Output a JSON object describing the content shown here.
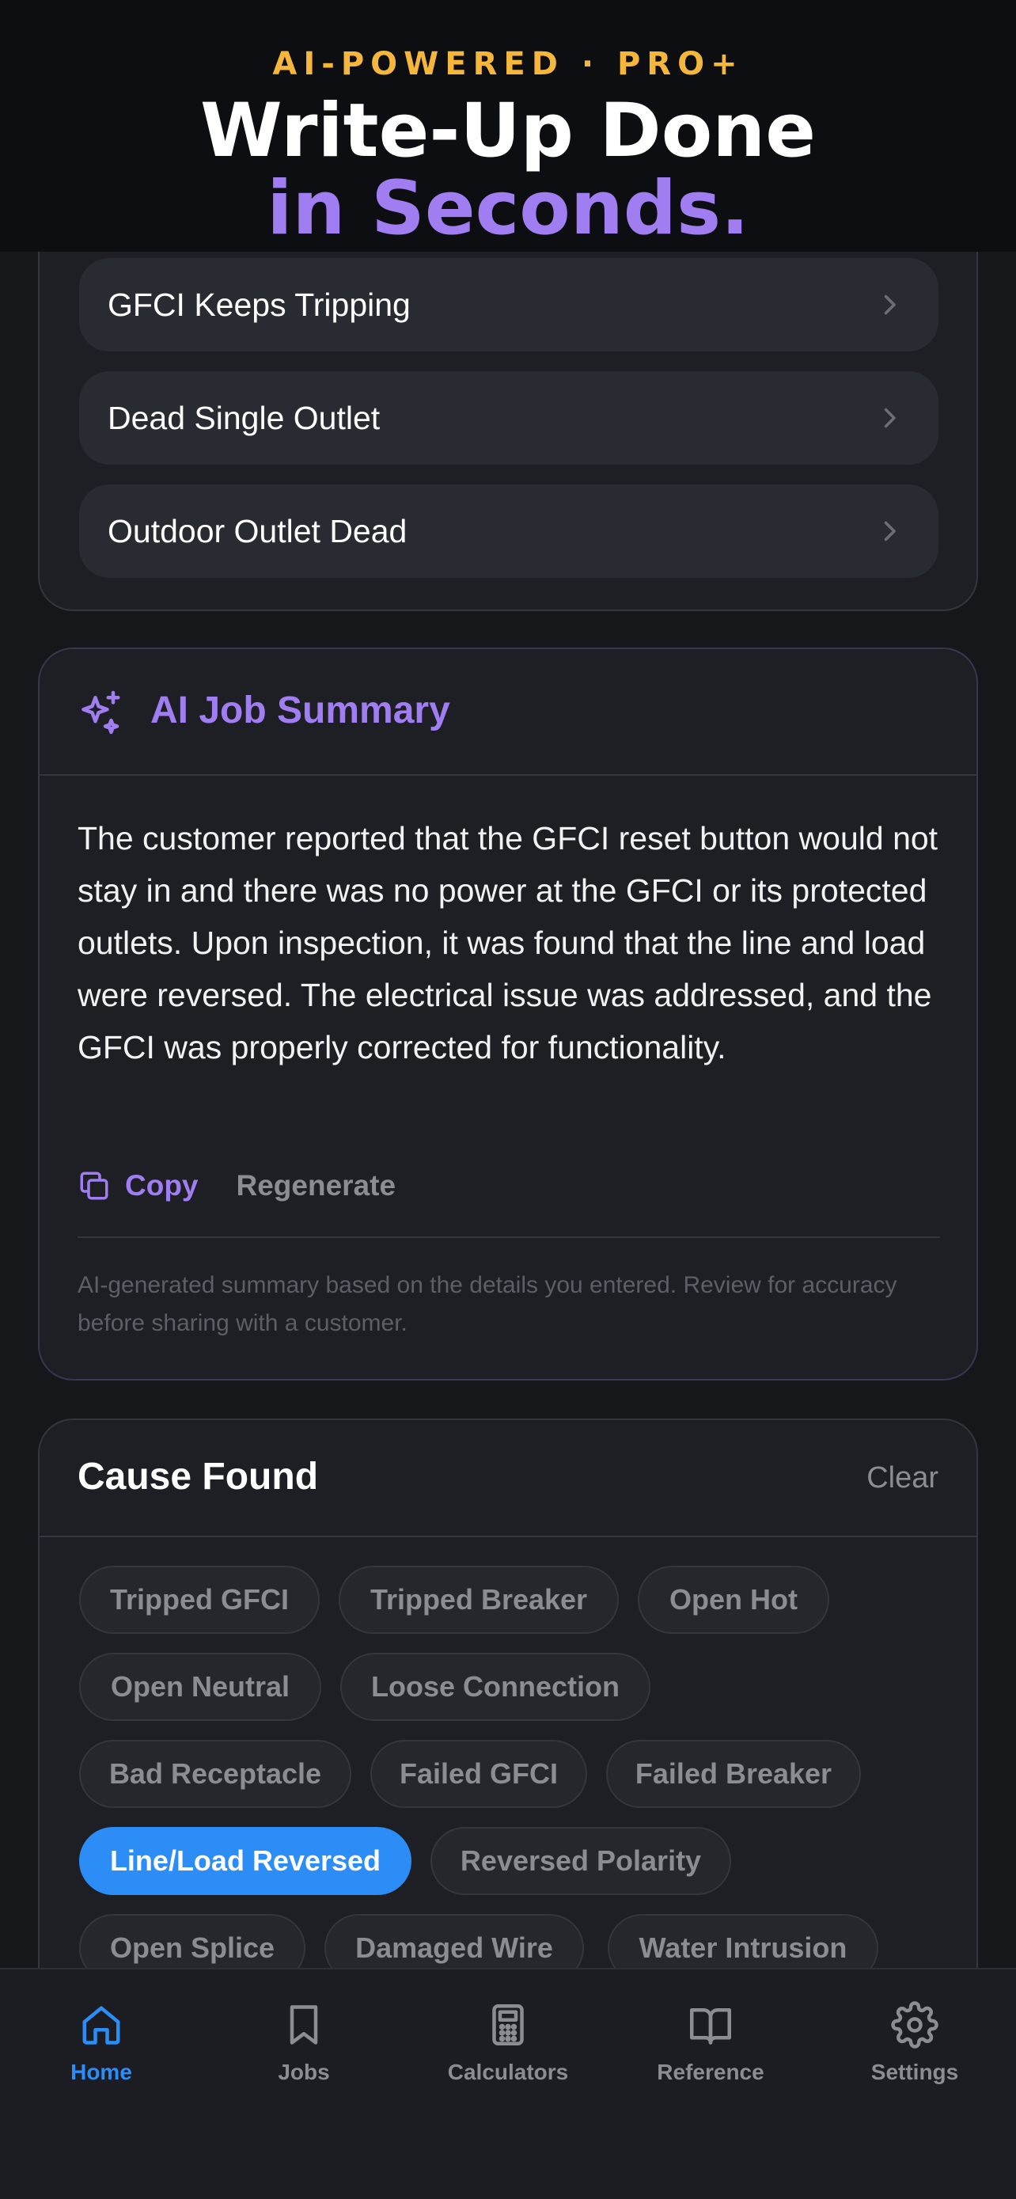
{
  "promo": {
    "kicker": "AI-POWERED · PRO+",
    "line1": "Write-Up Done",
    "line2": "in Seconds."
  },
  "symptoms": {
    "items": [
      {
        "label": "GFCI Keeps Tripping"
      },
      {
        "label": "Dead Single Outlet"
      },
      {
        "label": "Outdoor Outlet Dead"
      }
    ]
  },
  "ai_summary": {
    "title": "AI Job Summary",
    "icon": "sparkle-icon",
    "body": "The customer reported that the GFCI reset button would not stay in and there was no power at the GFCI or its protected outlets. Upon inspection, it was found that the line and load were reversed. The electrical issue was addressed, and the GFCI was properly corrected for functionality.",
    "copy_label": "Copy",
    "regenerate_label": "Regenerate",
    "note": "AI-generated summary based on the details you entered. Review for accuracy before sharing with a customer."
  },
  "cause": {
    "title": "Cause Found",
    "clear_label": "Clear",
    "selected": "Line/Load Reversed",
    "chips": [
      {
        "label": "Tripped GFCI"
      },
      {
        "label": "Tripped Breaker"
      },
      {
        "label": "Open Hot"
      },
      {
        "label": "Open Neutral"
      },
      {
        "label": "Loose Connection"
      },
      {
        "label": "Bad Receptacle"
      },
      {
        "label": "Failed GFCI"
      },
      {
        "label": "Failed Breaker"
      },
      {
        "label": "Line/Load Reversed"
      },
      {
        "label": "Reversed Polarity"
      },
      {
        "label": "Open Splice"
      },
      {
        "label": "Damaged Wire"
      },
      {
        "label": "Water Intrusion"
      }
    ]
  },
  "nav": {
    "active": "Home",
    "tabs": [
      {
        "label": "Home",
        "icon": "home-icon"
      },
      {
        "label": "Jobs",
        "icon": "bookmark-icon"
      },
      {
        "label": "Calculators",
        "icon": "calculator-icon"
      },
      {
        "label": "Reference",
        "icon": "book-icon"
      },
      {
        "label": "Settings",
        "icon": "gear-icon"
      }
    ]
  },
  "colors": {
    "accent_purple": "#a07ef2",
    "accent_blue": "#2b8df5",
    "kicker_gold": "#f4b73c",
    "background": "#15171b",
    "card": "#1d1f24"
  }
}
